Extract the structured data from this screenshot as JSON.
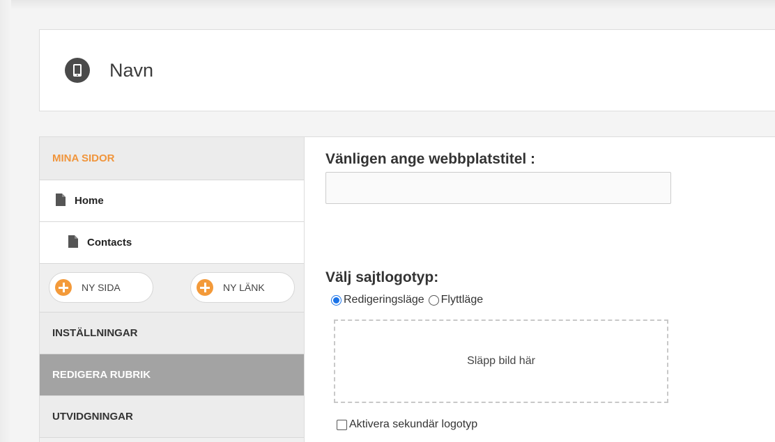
{
  "header": {
    "title": "Navn",
    "icon": "mobile-phone-icon"
  },
  "sidebar": {
    "heading": "MINA SIDOR",
    "pages": [
      {
        "label": "Home",
        "icon": "document-icon"
      },
      {
        "label": "Contacts",
        "icon": "document-icon"
      }
    ],
    "new_page_label": "NY SIDA",
    "new_link_label": "NY LÄNK",
    "sections": [
      {
        "label": "INSTÄLLNINGAR",
        "active": false
      },
      {
        "label": "REDIGERA RUBRIK",
        "active": true
      },
      {
        "label": "UTVIDGNINGAR",
        "active": false
      }
    ]
  },
  "form": {
    "site_title_label": "Vänligen ange webbplatstitel :",
    "site_title_value": "",
    "logo_label": "Välj sajtlogotyp:",
    "mode_options": [
      "Redigeringsläge",
      "Flyttläge"
    ],
    "selected_mode": "Redigeringsläge",
    "dropzone_text": "Släpp bild här",
    "secondary_logo_label": "Aktivera sekundär logotyp",
    "secondary_logo_checked": false
  },
  "colors": {
    "accent_orange": "#f39a3a",
    "heading_orange": "#f0953c",
    "active_section": "#a3a3a3",
    "radio_blue": "#1a73e8"
  }
}
